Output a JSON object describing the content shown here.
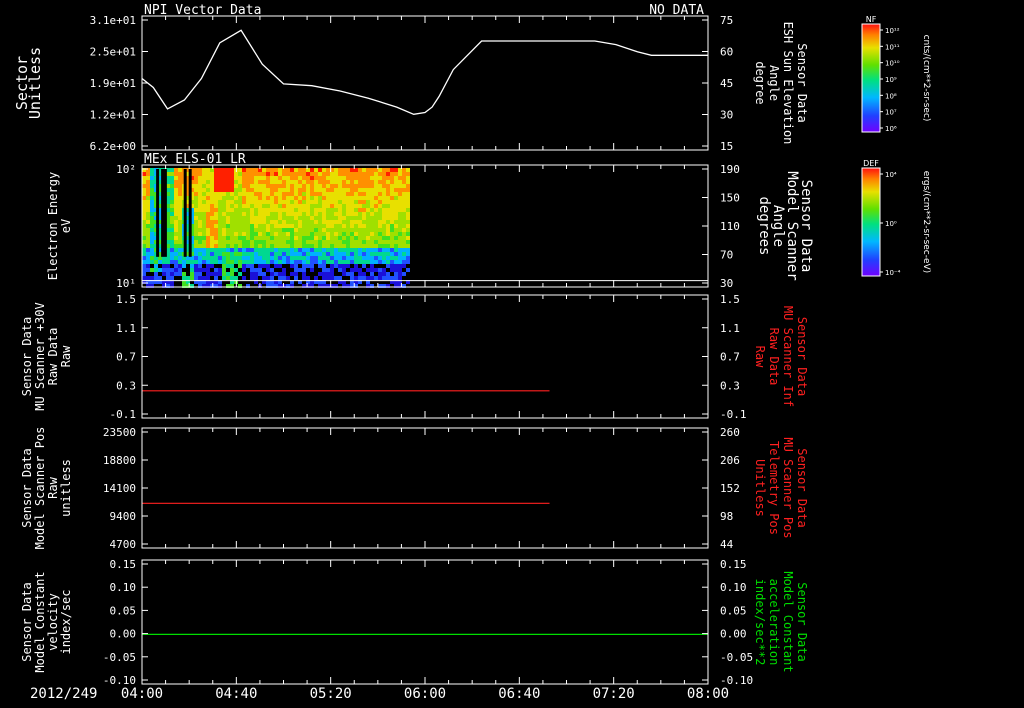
{
  "date_label": "2012/249",
  "x_ticks": [
    "04:00",
    "04:40",
    "05:20",
    "06:00",
    "06:40",
    "07:20",
    "08:00"
  ],
  "x_range_hours": [
    4,
    8
  ],
  "colors": {
    "axis": "#ffffff",
    "red_trace": "#ff2020",
    "green_trace": "#00dd00",
    "red_label": "#ff2020",
    "green_label": "#00dd00"
  },
  "colorbars": [
    {
      "tag": "NF",
      "unit": "cnts/(cm**2-sr-sec)",
      "ticks": [
        "10¹²",
        "10¹¹",
        "10¹⁰",
        "10⁹",
        "10⁸",
        "10⁷",
        "10⁶"
      ]
    },
    {
      "tag": "DEF",
      "unit": "ergs/(cm**2-sr-sec-eV)",
      "ticks": [
        "10⁴",
        "10⁰",
        "10⁻⁴"
      ]
    }
  ],
  "chart_data": [
    {
      "type": "line",
      "title_left": "NPI Vector Data",
      "title_right": "NO DATA",
      "ylabel_left": [
        "Sector",
        "Unitless"
      ],
      "ylabel_right": [
        "Sensor Data",
        "ESH Sun Elevation",
        "Angle",
        "degree"
      ],
      "yticks_left": [
        "3.1e+01",
        "2.5e+01",
        "1.9e+01",
        "1.2e+01",
        "6.2e+00"
      ],
      "yticks_right": [
        "75",
        "60",
        "45",
        "30",
        "15"
      ],
      "ylim_right": [
        0,
        75
      ],
      "series": [
        {
          "color": "#ffffff",
          "x": [
            4.0,
            4.08,
            4.18,
            4.3,
            4.42,
            4.55,
            4.7,
            4.85,
            5.0,
            5.2,
            5.4,
            5.6,
            5.8,
            5.92,
            6.0,
            6.05,
            6.1,
            6.2,
            6.4,
            6.7,
            7.0,
            7.2,
            7.35,
            7.5,
            7.6,
            8.0
          ],
          "y": [
            40,
            35,
            23,
            28,
            40,
            60,
            67,
            48,
            37,
            36,
            33,
            29,
            24,
            20,
            21,
            24,
            30,
            45,
            61,
            61,
            61,
            61,
            59,
            55,
            53,
            53
          ]
        }
      ]
    },
    {
      "type": "heatmap",
      "title_left": "MEx ELS-01 LR",
      "ylabel_left": [
        "Electron Energy",
        "eV"
      ],
      "ylabel_right": [
        "Sensor Data",
        "Model Scanner",
        "Angle",
        "degrees"
      ],
      "yticks_left": [
        "10²",
        "10¹"
      ],
      "yticks_right": [
        "190",
        "150",
        "110",
        "70",
        "30"
      ],
      "ylim_right": [
        0,
        190
      ],
      "data_coverage_hours": [
        4.0,
        5.87
      ],
      "baseline_degrees": 10
    },
    {
      "type": "line",
      "ylabel_left": [
        "Sensor Data",
        "MU Scanner +30V",
        "Raw Data",
        "Raw"
      ],
      "ylabel_right": [
        "Sensor Data",
        "MU Scanner Inf",
        "Raw Data",
        "Raw"
      ],
      "yticks_left": [
        "1.5",
        "1.1",
        "0.7",
        "0.3",
        "-0.1"
      ],
      "yticks_right": [
        "1.5",
        "1.1",
        "0.7",
        "0.3",
        "-0.1"
      ],
      "ylim": [
        -0.4,
        1.5
      ],
      "series": [
        {
          "color": "#ff2020",
          "x": [
            4.0,
            6.88
          ],
          "y": [
            0.02,
            0.02
          ]
        }
      ]
    },
    {
      "type": "line",
      "ylabel_left": [
        "Sensor Data",
        "Model Scanner Pos",
        "Raw",
        "unitless"
      ],
      "ylabel_right": [
        "Sensor Data",
        "MU Scanner Pos",
        "Telemetry Pos",
        "Unitless"
      ],
      "yticks_left": [
        "23500",
        "18800",
        "14100",
        "9400",
        "4700"
      ],
      "yticks_right": [
        "260",
        "206",
        "152",
        "98",
        "44"
      ],
      "ylim": [
        0,
        23500
      ],
      "series": [
        {
          "color": "#ff2020",
          "x": [
            4.0,
            6.88
          ],
          "y": [
            8750,
            8750
          ]
        }
      ]
    },
    {
      "type": "line",
      "ylabel_left": [
        "Sensor Data",
        "Model Constant",
        "velocity",
        "index/sec"
      ],
      "ylabel_right": [
        "Sensor Data",
        "Model Constant",
        "acceleration",
        "index/sec**2"
      ],
      "yticks_left": [
        "0.15",
        "0.10",
        "0.05",
        "0.00",
        "-0.05",
        "-0.10"
      ],
      "yticks_right": [
        "0.15",
        "0.10",
        "0.05",
        "0.00",
        "-0.05",
        "-0.10"
      ],
      "ylim": [
        -0.1,
        0.15
      ],
      "series": [
        {
          "color": "#00dd00",
          "x": [
            4.0,
            8.0
          ],
          "y": [
            0.0,
            0.0
          ]
        }
      ]
    }
  ]
}
